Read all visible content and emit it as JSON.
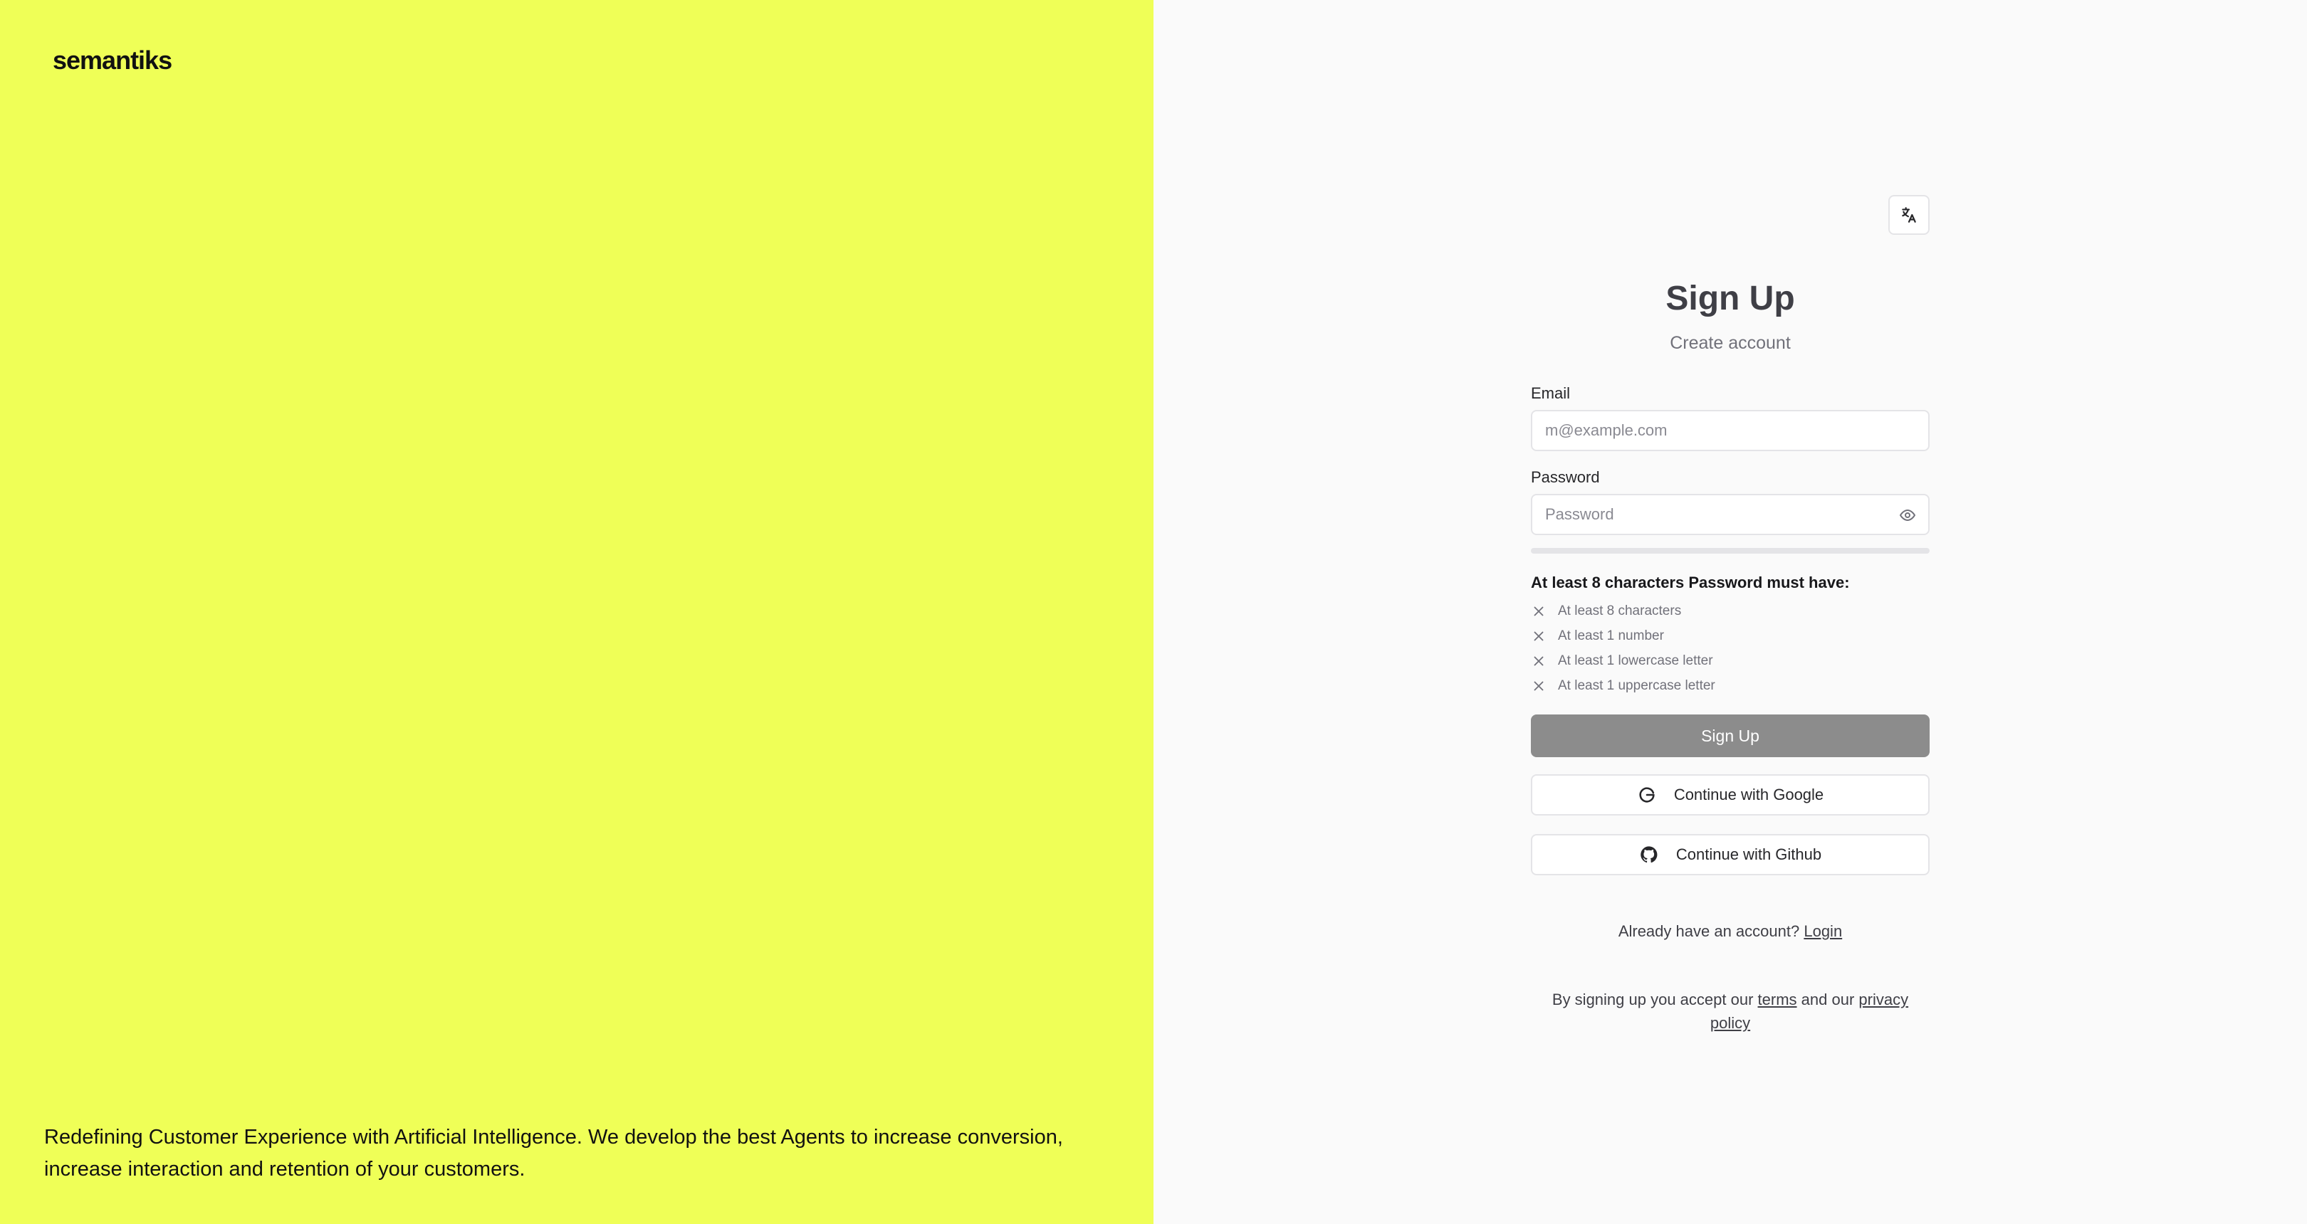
{
  "brand": {
    "logo_text": "semantiks",
    "tagline": "Redefining Customer Experience with Artificial Intelligence. We develop the best Agents to increase conversion, increase interaction and retention of your customers.",
    "panel_color": "#efff57"
  },
  "language_button": {
    "icon": "translate-icon"
  },
  "form": {
    "title": "Sign Up",
    "subtitle": "Create account",
    "email": {
      "label": "Email",
      "placeholder": "m@example.com",
      "value": ""
    },
    "password": {
      "label": "Password",
      "placeholder": "Password",
      "value": "",
      "toggle_icon": "eye-icon"
    },
    "requirements": {
      "title": "At least 8 characters Password must have:",
      "items": [
        {
          "label": "At least 8 characters",
          "status_icon": "x-icon"
        },
        {
          "label": "At least 1 number",
          "status_icon": "x-icon"
        },
        {
          "label": "At least 1 lowercase letter",
          "status_icon": "x-icon"
        },
        {
          "label": "At least 1 uppercase letter",
          "status_icon": "x-icon"
        }
      ]
    },
    "submit_label": "Sign Up",
    "google_label": "Continue with Google",
    "github_label": "Continue with Github"
  },
  "login": {
    "prompt": "Already have an account?",
    "link_label": "Login"
  },
  "legal": {
    "prefix": "By signing up you accept our",
    "terms_label": "terms",
    "middle": "and our",
    "privacy_label": "privacy policy"
  }
}
